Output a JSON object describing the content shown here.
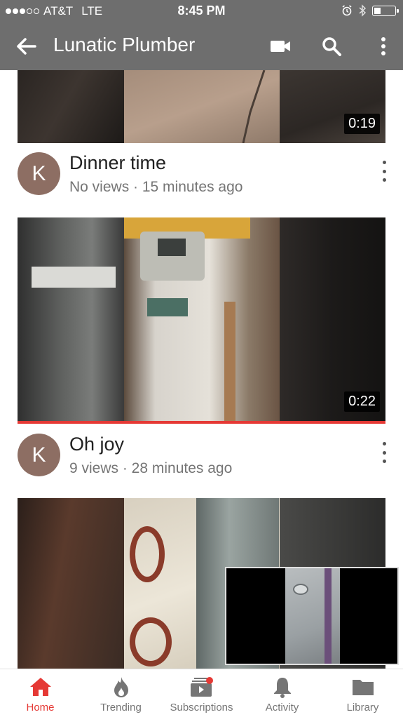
{
  "status_bar": {
    "carrier": "AT&T",
    "network": "LTE",
    "time": "8:45 PM",
    "signal_bars": 3,
    "signal_total": 5,
    "battery_level": 0.35
  },
  "app_bar": {
    "title": "Lunatic Plumber",
    "icons": [
      "back-arrow-icon",
      "video-camera-icon",
      "search-icon",
      "more-vert-icon"
    ]
  },
  "videos": [
    {
      "duration": "0:19"
    },
    {
      "title": "Dinner time",
      "subtitle": "No views · 15 minutes ago",
      "avatar_letter": "K",
      "duration": "0:22",
      "watch_progress": 1.0
    },
    {
      "title": "Oh joy",
      "subtitle": "9 views · 28 minutes ago",
      "avatar_letter": "K"
    }
  ],
  "bottom_nav": [
    {
      "label": "Home",
      "icon": "home-icon",
      "active": true
    },
    {
      "label": "Trending",
      "icon": "flame-icon",
      "active": false
    },
    {
      "label": "Subscriptions",
      "icon": "subscriptions-icon",
      "active": false
    },
    {
      "label": "Activity",
      "icon": "bell-icon",
      "active": false
    },
    {
      "label": "Library",
      "icon": "folder-icon",
      "active": false
    }
  ],
  "colors": {
    "app_bar": "#6e6e6e",
    "accent": "#e53935",
    "avatar": "#8d6e63"
  }
}
